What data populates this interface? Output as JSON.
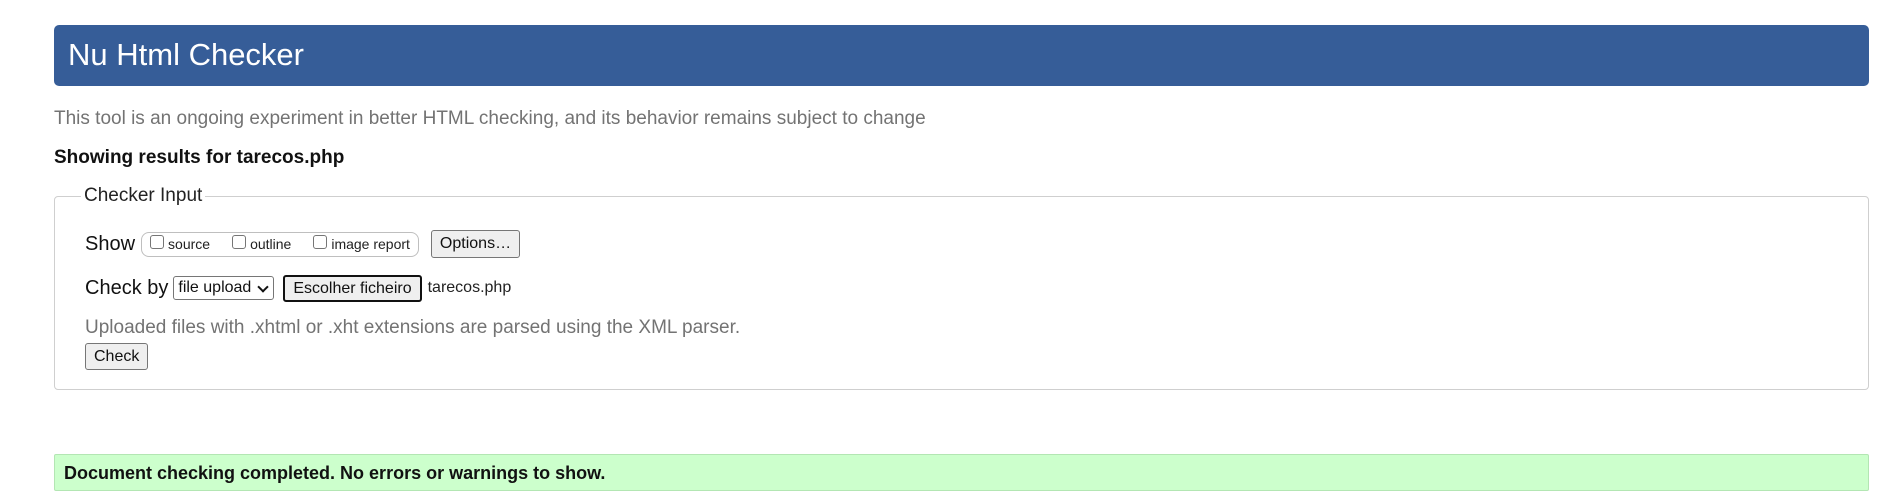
{
  "header": {
    "title": "Nu Html Checker"
  },
  "tagline": "This tool is an ongoing experiment in better HTML checking, and its behavior remains subject to change",
  "results_for": "Showing results for tarecos.php",
  "checker_input": {
    "legend": "Checker Input",
    "show_label": "Show",
    "show_options": [
      {
        "label": "source",
        "checked": false
      },
      {
        "label": "outline",
        "checked": false
      },
      {
        "label": "image report",
        "checked": false
      }
    ],
    "options_button": "Options…",
    "check_by_label": "Check by",
    "check_by_selected": "file upload",
    "file_button": "Escolher ficheiro",
    "file_name": "tarecos.php",
    "xml_note": "Uploaded files with .xhtml or .xht extensions are parsed using the XML parser.",
    "check_button": "Check"
  },
  "result_message": "Document checking completed. No errors or warnings to show.",
  "colors": {
    "header_bg": "#365d98",
    "success_bg": "#ccffcc",
    "muted_text": "#737373"
  }
}
